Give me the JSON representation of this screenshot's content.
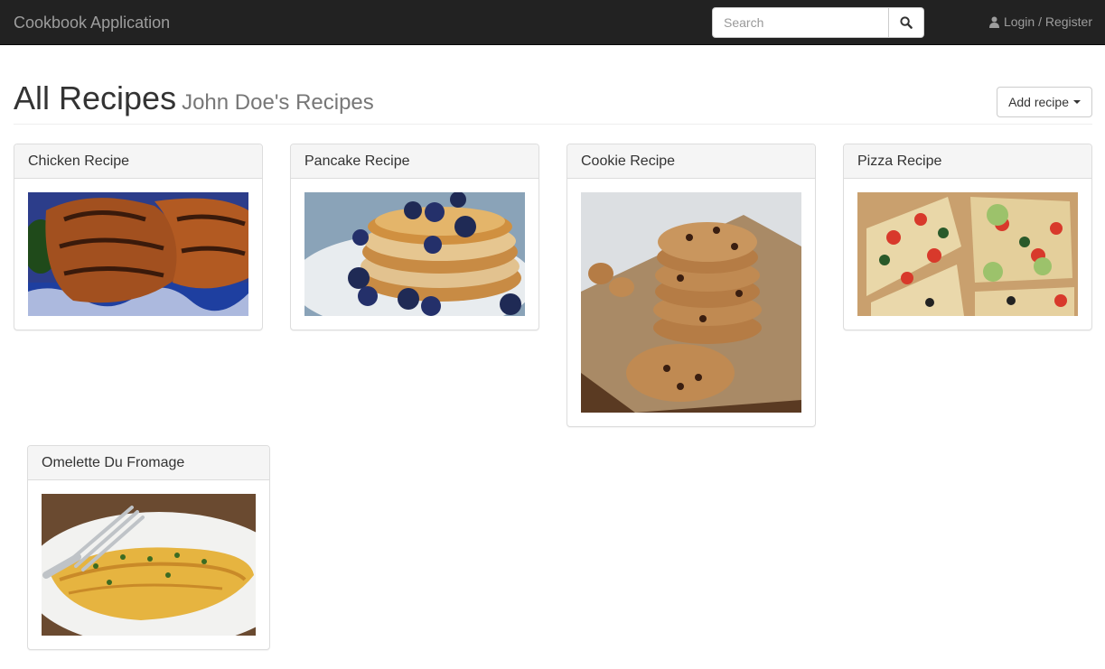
{
  "navbar": {
    "brand": "Cookbook Application",
    "search_placeholder": "Search",
    "search_icon": "search-icon",
    "login_icon": "user-icon",
    "login_text": "Login / Register",
    "colors": {
      "background": "#222222",
      "text": "#9d9d9d"
    }
  },
  "header": {
    "title": "All Recipes",
    "subtitle": "John Doe's Recipes",
    "add_button": "Add recipe"
  },
  "recipes": [
    {
      "title": "Chicken Recipe",
      "image": "grilled-chicken-photo"
    },
    {
      "title": "Pancake Recipe",
      "image": "blueberry-pancakes-photo"
    },
    {
      "title": "Cookie Recipe",
      "image": "chocolate-chip-cookies-photo"
    },
    {
      "title": "Pizza Recipe",
      "image": "vegetable-pizza-photo"
    },
    {
      "title": "Omelette Du Fromage",
      "image": "cheese-omelette-photo"
    }
  ]
}
